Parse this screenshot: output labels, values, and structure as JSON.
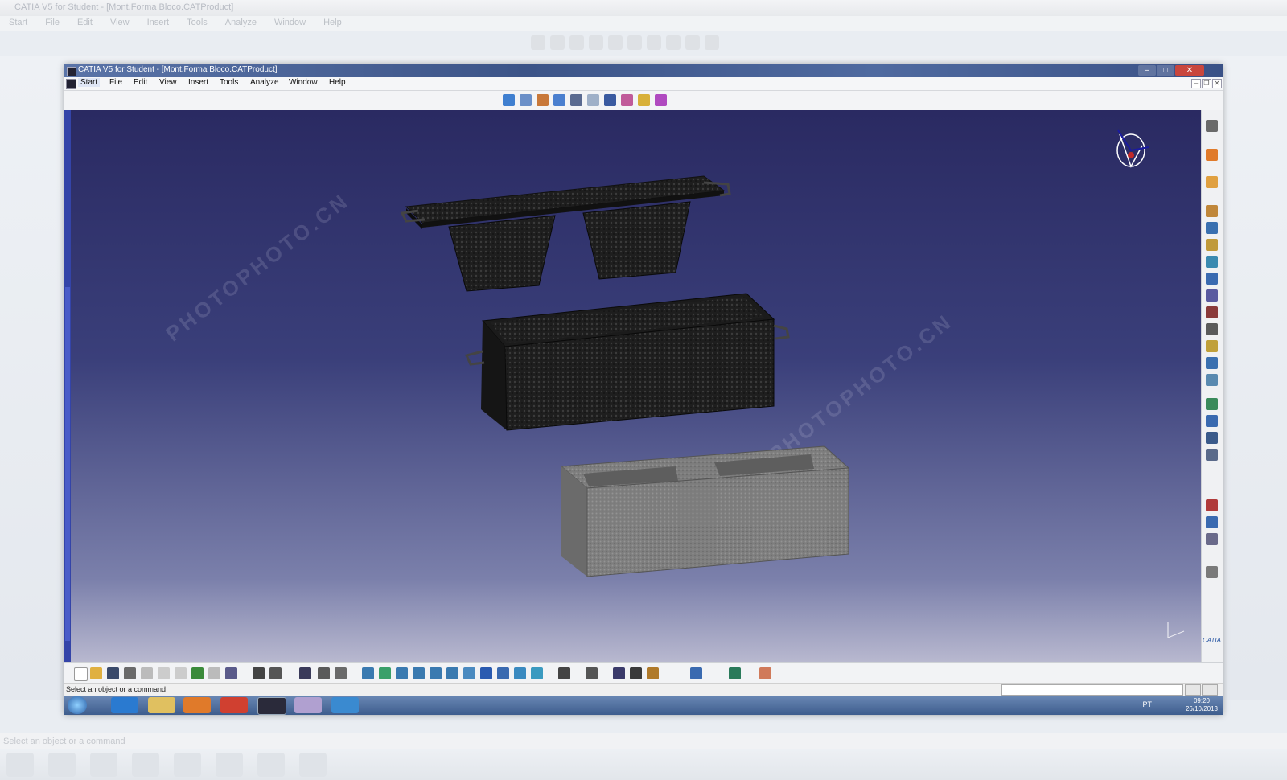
{
  "background_window": {
    "title": "CATIA V5 for Student - [Mont.Forma Bloco.CATProduct]",
    "menu": [
      "Start",
      "File",
      "Edit",
      "View",
      "Insert",
      "Tools",
      "Analyze",
      "Window",
      "Help"
    ],
    "status": "Select an object or a command"
  },
  "window": {
    "title": "CATIA V5 for Student - [Mont.Forma Bloco.CATProduct]",
    "controls": {
      "minimize": "–",
      "maximize": "□",
      "close": "✕"
    },
    "mdi_controls": {
      "minimize": "–",
      "restore": "❐",
      "close": "✕"
    }
  },
  "menu": {
    "start": "Start",
    "file": "File",
    "edit": "Edit",
    "view": "View",
    "insert": "Insert",
    "tools": "Tools",
    "analyze": "Analyze",
    "window": "Window",
    "help": "Help"
  },
  "status": {
    "message": "Select an object or a command",
    "input_value": ""
  },
  "taskbar": {
    "language": "PT",
    "time": "09:20",
    "date": "26/10/2013"
  },
  "watermark": {
    "text": "PHOTOPHOTO.CN"
  },
  "brand": {
    "logo": "CATIA"
  },
  "colors": {
    "viewport_top": "#2a2a62",
    "viewport_bottom": "#b8b8cf",
    "dark_part": "#262626",
    "gray_part": "#8a8a8a",
    "title_bar": "#3c5488"
  },
  "icons": {
    "top_toolbar": [
      "sketch-icon",
      "pad-icon",
      "assembly-icon",
      "surface-icon",
      "sheetmetal-icon",
      "drafting-icon",
      "catalog-icon",
      "mold-icon",
      "analysis-icon",
      "kinematics-icon"
    ],
    "right_toolbar": [
      "compass-icon",
      "select-icon",
      "product-icon",
      "component-icon",
      "part-icon",
      "insert-icon",
      "replace-icon",
      "reorder-icon",
      "constraint-icon",
      "fix-icon",
      "coincidence-icon",
      "contact-icon",
      "offset-icon",
      "angle-icon",
      "manipulate-icon",
      "snap-icon",
      "explode-icon",
      "clash-icon",
      "section-icon",
      "distance-icon",
      "annotation-icon",
      "update-icon"
    ],
    "bottom_toolbar": [
      "new-icon",
      "open-icon",
      "save-icon",
      "print-icon",
      "cut-icon",
      "copy-icon",
      "paste-icon",
      "undo-icon",
      "redo-icon",
      "whats-this-icon",
      "formula-icon",
      "comment-icon",
      "table-icon",
      "measure-icon",
      "properties-icon",
      "fly-icon",
      "fit-all-icon",
      "pan-icon",
      "rotate-icon",
      "zoom-in-icon",
      "zoom-out-icon",
      "normal-view-icon",
      "iso-view-icon",
      "shading-icon",
      "hide-show-icon",
      "swap-icon",
      "capture-icon",
      "camera-icon",
      "update-all-icon",
      "catalog-browser-icon",
      "parameters-icon",
      "refresh-icon",
      "grid-icon"
    ],
    "taskbar": [
      "windows-start-icon",
      "internet-explorer-icon",
      "file-explorer-icon",
      "media-player-icon",
      "chrome-icon",
      "catia-task-icon",
      "paint-icon",
      "network-icon"
    ]
  }
}
